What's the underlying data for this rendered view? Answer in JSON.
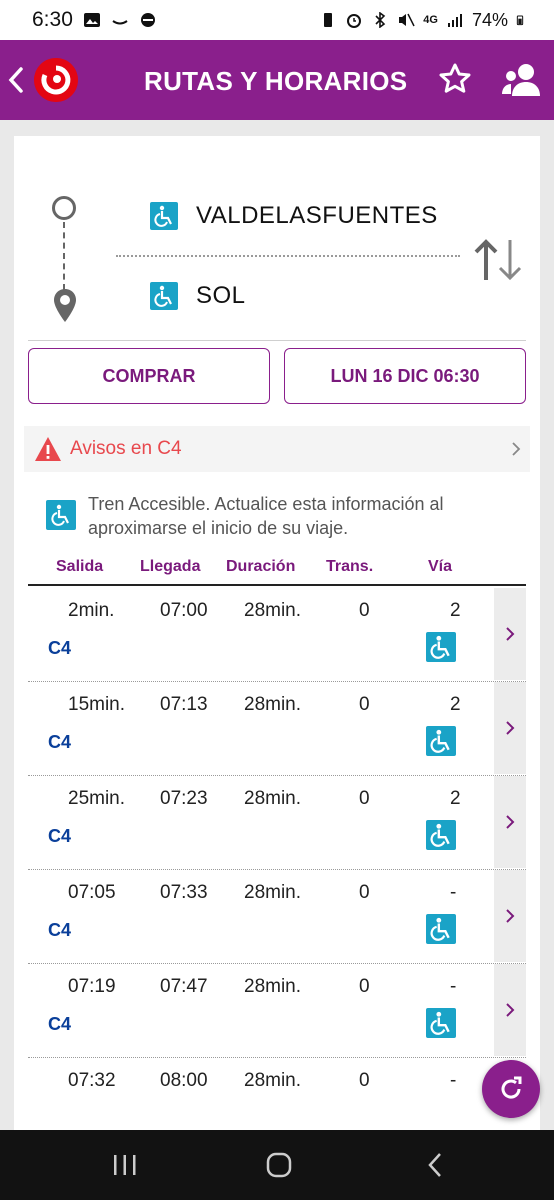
{
  "status_bar": {
    "time": "6:30",
    "network": "4G",
    "battery": "74%"
  },
  "header": {
    "title": "RUTAS Y HORARIOS"
  },
  "route": {
    "origin": "VALDELASFUENTES",
    "destination": "SOL"
  },
  "buttons": {
    "buy": "COMPRAR",
    "date": "LUN 16 DIC 06:30"
  },
  "alerts": {
    "label": "Avisos en C4"
  },
  "accessibility_note": "Tren Accesible. Actualice esta información al aproximarse el inicio de su viaje.",
  "table": {
    "headers": {
      "salida": "Salida",
      "llegada": "Llegada",
      "duracion": "Duración",
      "trans": "Trans.",
      "via": "Vía"
    },
    "rows": [
      {
        "salida": "2min.",
        "llegada": "07:00",
        "duracion": "28min.",
        "trans": "0",
        "via": "2",
        "line": "C4",
        "accessible": true
      },
      {
        "salida": "15min.",
        "llegada": "07:13",
        "duracion": "28min.",
        "trans": "0",
        "via": "2",
        "line": "C4",
        "accessible": true
      },
      {
        "salida": "25min.",
        "llegada": "07:23",
        "duracion": "28min.",
        "trans": "0",
        "via": "2",
        "line": "C4",
        "accessible": true
      },
      {
        "salida": "07:05",
        "llegada": "07:33",
        "duracion": "28min.",
        "trans": "0",
        "via": "-",
        "line": "C4",
        "accessible": true
      },
      {
        "salida": "07:19",
        "llegada": "07:47",
        "duracion": "28min.",
        "trans": "0",
        "via": "-",
        "line": "C4",
        "accessible": true
      },
      {
        "salida": "07:32",
        "llegada": "08:00",
        "duracion": "28min.",
        "trans": "0",
        "via": "-",
        "line": "",
        "accessible": false
      }
    ]
  },
  "colors": {
    "brand": "#8a1f8c",
    "alert": "#e8484d",
    "line": "#0a3f9a",
    "accessible": "#1aa3c7"
  },
  "icons": {
    "back": "chevron-left-icon",
    "logo": "renfe-cercanias-logo",
    "favorite": "star-icon",
    "users": "users-icon",
    "swap": "swap-icon",
    "warning": "warning-icon",
    "wheelchair": "wheelchair-icon",
    "refresh": "refresh-icon"
  }
}
